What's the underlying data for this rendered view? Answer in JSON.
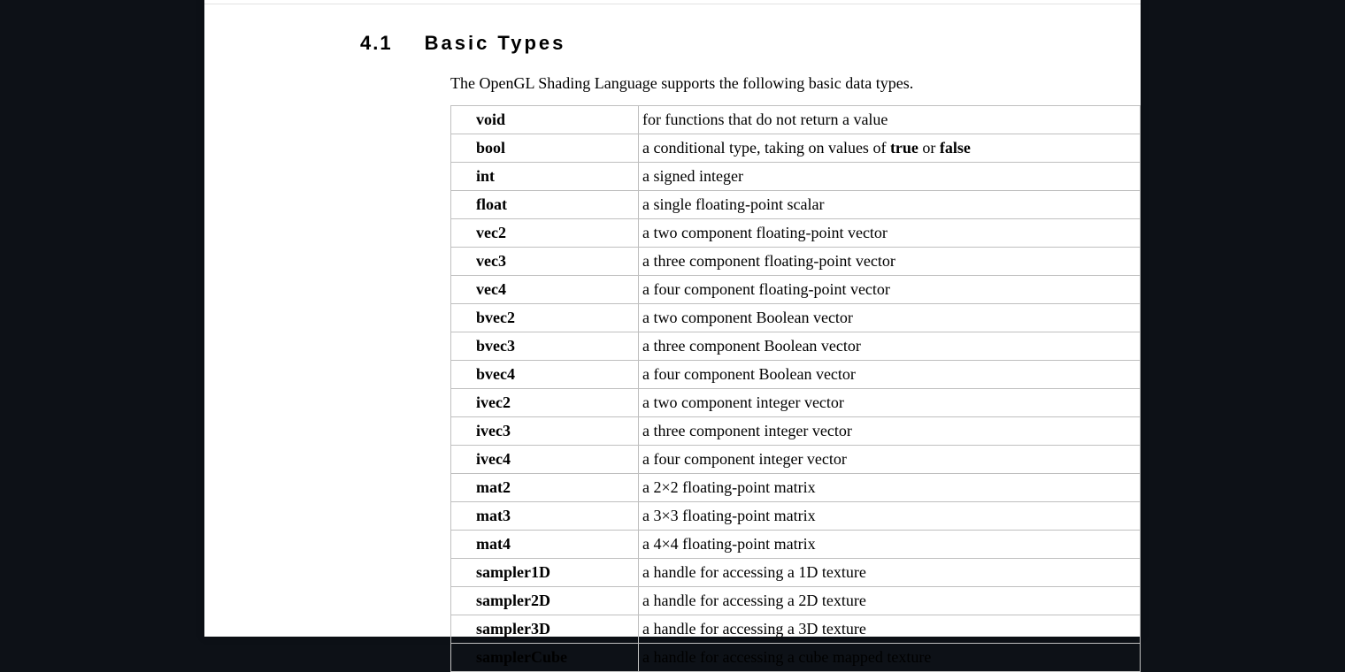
{
  "section_number": "4.1",
  "section_title": "Basic Types",
  "intro_text": "The OpenGL Shading Language supports the following basic data types.",
  "types": [
    {
      "name": "void",
      "desc": "for functions that do not return a value"
    },
    {
      "name": "bool",
      "desc": "a conditional type, taking on values of <b>true</b> or <b>false</b>"
    },
    {
      "name": "int",
      "desc": "a signed integer"
    },
    {
      "name": "float",
      "desc": "a single floating-point scalar"
    },
    {
      "name": "vec2",
      "desc": "a two component floating-point vector"
    },
    {
      "name": "vec3",
      "desc": "a three component floating-point vector"
    },
    {
      "name": "vec4",
      "desc": "a four component floating-point vector"
    },
    {
      "name": "bvec2",
      "desc": "a two component Boolean vector"
    },
    {
      "name": "bvec3",
      "desc": "a three component Boolean vector"
    },
    {
      "name": "bvec4",
      "desc": "a four component Boolean vector"
    },
    {
      "name": "ivec2",
      "desc": "a two component integer vector"
    },
    {
      "name": "ivec3",
      "desc": "a three component integer vector"
    },
    {
      "name": "ivec4",
      "desc": "a four component integer vector"
    },
    {
      "name": "mat2",
      "desc": "a 2×2 floating-point matrix"
    },
    {
      "name": "mat3",
      "desc": "a 3×3 floating-point matrix"
    },
    {
      "name": "mat4",
      "desc": "a 4×4 floating-point matrix"
    },
    {
      "name": "sampler1D",
      "desc": "a handle for accessing a 1D texture"
    },
    {
      "name": "sampler2D",
      "desc": "a handle for accessing a 2D texture"
    },
    {
      "name": "sampler3D",
      "desc": "a handle for accessing a 3D texture"
    },
    {
      "name": "samplerCube",
      "desc": "a handle for accessing a cube mapped texture"
    }
  ]
}
